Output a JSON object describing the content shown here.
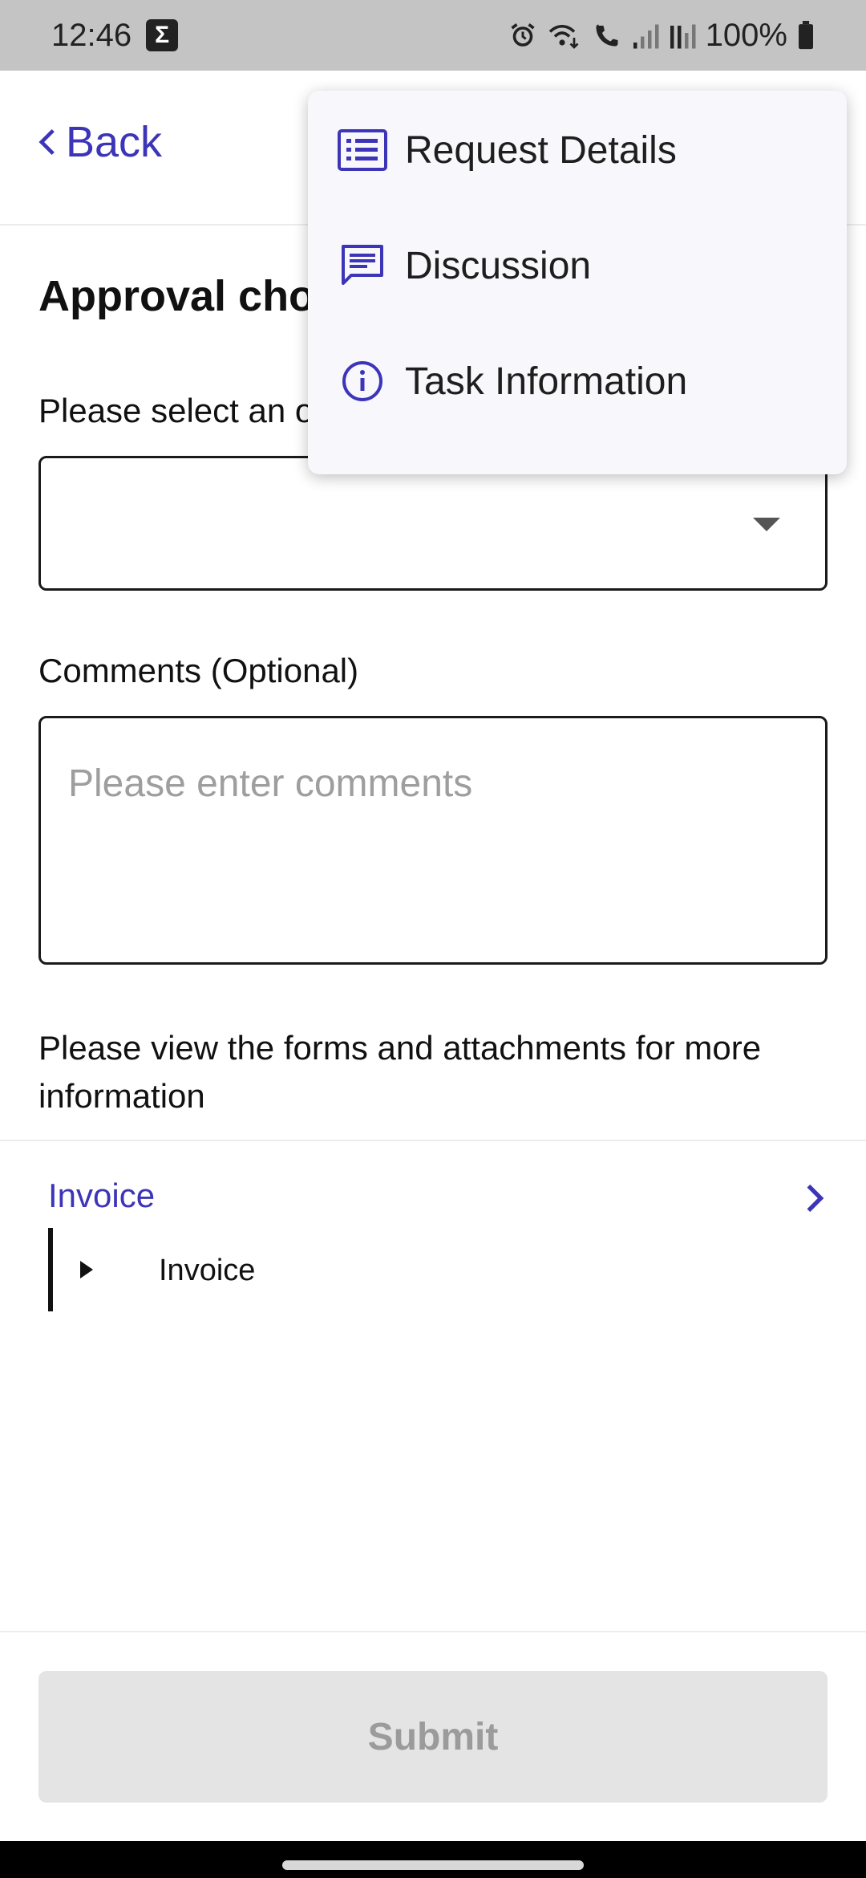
{
  "status_bar": {
    "time": "12:46",
    "app_badge": "Σ",
    "battery": "100%"
  },
  "header": {
    "back_label": "Back"
  },
  "form": {
    "heading": "Approval choi",
    "select_label": "Please select an o",
    "comments_label": "Comments (Optional)",
    "comments_placeholder": "Please enter comments",
    "info_text": "Please view the forms and attachments for more information"
  },
  "attachments": {
    "section_title": "Invoice",
    "items": [
      {
        "label": "Invoice"
      }
    ]
  },
  "submit_label": "Submit",
  "menu": {
    "items": [
      {
        "label": "Request Details",
        "icon": "list-icon"
      },
      {
        "label": "Discussion",
        "icon": "chat-icon"
      },
      {
        "label": "Task Information",
        "icon": "info-icon"
      }
    ]
  },
  "colors": {
    "accent": "#3d35b8",
    "menu_background": "#f8f7fc",
    "status_bar": "#c4c4c4",
    "submit_disabled": "#e4e4e4"
  }
}
